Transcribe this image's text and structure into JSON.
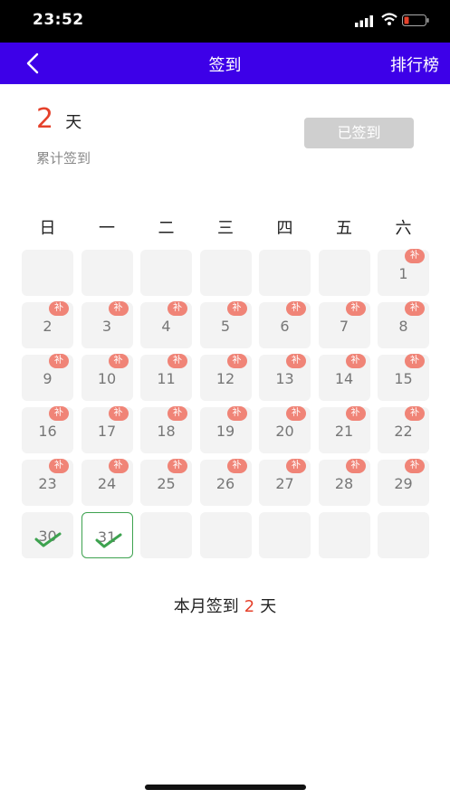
{
  "status_bar": {
    "time": "23:52"
  },
  "nav": {
    "title": "签到",
    "rank_label": "排行榜"
  },
  "summary": {
    "count": "2",
    "unit": "天",
    "label": "累计签到",
    "signed_button": "已签到"
  },
  "weekdays": [
    "日",
    "一",
    "二",
    "三",
    "四",
    "五",
    "六"
  ],
  "calendar": {
    "makeup_badge": "补",
    "days": [
      {
        "day": "1",
        "badge": true
      },
      {
        "day": "2",
        "badge": true
      },
      {
        "day": "3",
        "badge": true
      },
      {
        "day": "4",
        "badge": true
      },
      {
        "day": "5",
        "badge": true
      },
      {
        "day": "6",
        "badge": true
      },
      {
        "day": "7",
        "badge": true
      },
      {
        "day": "8",
        "badge": true
      },
      {
        "day": "9",
        "badge": true
      },
      {
        "day": "10",
        "badge": true
      },
      {
        "day": "11",
        "badge": true
      },
      {
        "day": "12",
        "badge": true
      },
      {
        "day": "13",
        "badge": true
      },
      {
        "day": "14",
        "badge": true
      },
      {
        "day": "15",
        "badge": true
      },
      {
        "day": "16",
        "badge": true
      },
      {
        "day": "17",
        "badge": true
      },
      {
        "day": "18",
        "badge": true
      },
      {
        "day": "19",
        "badge": true
      },
      {
        "day": "20",
        "badge": true
      },
      {
        "day": "21",
        "badge": true
      },
      {
        "day": "22",
        "badge": true
      },
      {
        "day": "23",
        "badge": true
      },
      {
        "day": "24",
        "badge": true
      },
      {
        "day": "25",
        "badge": true
      },
      {
        "day": "26",
        "badge": true
      },
      {
        "day": "27",
        "badge": true
      },
      {
        "day": "28",
        "badge": true
      },
      {
        "day": "29",
        "badge": true
      },
      {
        "day": "30",
        "badge": false,
        "checked": true
      },
      {
        "day": "31",
        "badge": false,
        "checked": true,
        "today": true
      }
    ]
  },
  "month_total": {
    "prefix": "本月签到",
    "count": "2",
    "unit": "天"
  },
  "colors": {
    "nav": "#3D00E8",
    "accent": "#E5412B",
    "badge": "#F08477",
    "check": "#3DA24F"
  }
}
